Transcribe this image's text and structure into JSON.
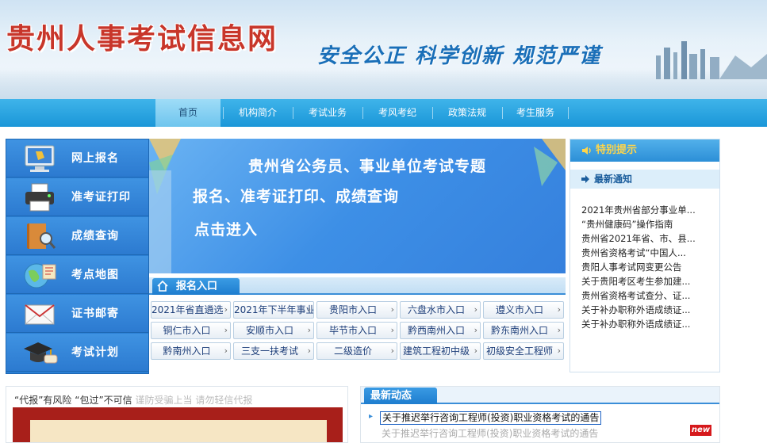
{
  "header": {
    "site_title": "贵州人事考试信息网",
    "slogan": "安全公正  科学创新  规范严谨"
  },
  "nav": {
    "items": [
      {
        "label": "首页",
        "active": true
      },
      {
        "label": "机构简介"
      },
      {
        "label": "考试业务"
      },
      {
        "label": "考风考纪"
      },
      {
        "label": "政策法规"
      },
      {
        "label": "考生服务"
      }
    ]
  },
  "left_menu": {
    "items": [
      {
        "label": "网上报名",
        "icon": "monitor-icon"
      },
      {
        "label": "准考证打印",
        "icon": "printer-icon"
      },
      {
        "label": "成绩查询",
        "icon": "book-search-icon"
      },
      {
        "label": "考点地图",
        "icon": "globe-map-icon"
      },
      {
        "label": "证书邮寄",
        "icon": "envelope-icon"
      },
      {
        "label": "考试计划",
        "icon": "graduation-cap-icon"
      }
    ]
  },
  "banner": {
    "line1": "贵州省公务员、事业单位考试专题",
    "line2": "报名、准考证打印、成绩查询",
    "line3": "点击进入"
  },
  "registration": {
    "title": "报名入口",
    "buttons": [
      "2021年省直遴选",
      "2021年下半年事业",
      "贵阳市入口",
      "六盘水市入口",
      "遵义市入口",
      "铜仁市入口",
      "安顺市入口",
      "毕节市入口",
      "黔西南州入口",
      "黔东南州入口",
      "黔南州入口",
      "三支一扶考试",
      "二级造价",
      "建筑工程初中级",
      "初级安全工程师"
    ]
  },
  "right": {
    "tip_title": "特别提示",
    "notice_title": "最新通知",
    "notices": [
      "2021年贵州省部分事业单...",
      "“贵州健康码”操作指南",
      "贵州省2021年省、市、县...",
      "贵州省资格考试“中国人...",
      "贵阳人事考试网变更公告",
      "关于贵阳考区考生参加建...",
      "贵州省资格考试查分、证...",
      "关于补办职称外语成绩证...",
      "关于补办职称外语成绩证..."
    ]
  },
  "bottom_left": {
    "marquee_text": "“代报”有风险  “包过”不可信",
    "marquee_faded": "  谨防受骗上当 请勿轻信代报"
  },
  "bottom_right": {
    "title": "最新动态",
    "news": [
      "关于推迟举行咨询工程师(投资)职业资格考试的通告",
      "关于推迟举行咨询工程师(投资)职业资格考试的通告"
    ],
    "new_badge": "new"
  },
  "colors": {
    "nav_bg": "#1a96d8",
    "menu_bg": "#2c7ad0",
    "title_red": "#c8362a",
    "slogan_blue": "#1a6fb8",
    "badge_red": "#d6191c"
  }
}
